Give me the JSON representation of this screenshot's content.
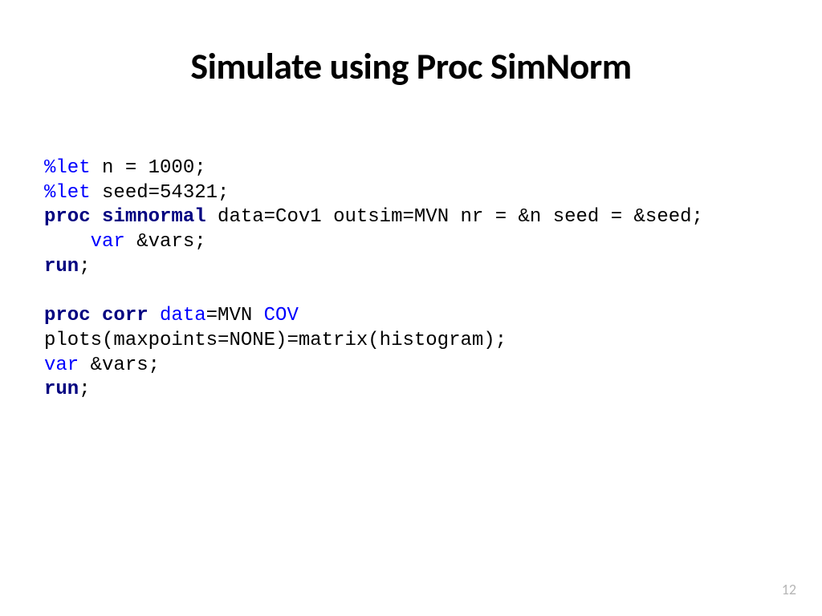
{
  "title": "Simulate using Proc SimNorm",
  "code": {
    "l1a": "%let",
    "l1b": " n = 1000;",
    "l2a": "%let",
    "l2b": " seed=54321;",
    "l3a": "proc",
    "l3b": " ",
    "l3c": "simnormal",
    "l3d": " data=Cov1 outsim=MVN nr = &n seed = &seed;",
    "l4a": "    var",
    "l4b": " &vars;",
    "l5a": "run",
    "l5b": ";",
    "blank": " ",
    "l7a": "proc",
    "l7b": " ",
    "l7c": "corr",
    "l7d": " ",
    "l7e": "data",
    "l7f": "=MVN ",
    "l7g": "COV",
    "l8": "plots(maxpoints=NONE)=matrix(histogram);",
    "l9a": "var",
    "l9b": " &vars;",
    "l10a": "run",
    "l10b": ";"
  },
  "page_number": "12"
}
